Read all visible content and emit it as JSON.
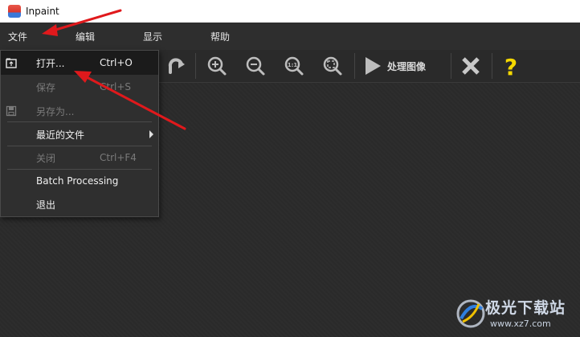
{
  "window": {
    "title": "Inpaint"
  },
  "menubar": {
    "items": [
      {
        "label": "文件"
      },
      {
        "label": "编辑"
      },
      {
        "label": "显示"
      },
      {
        "label": "帮助"
      }
    ]
  },
  "toolbar": {
    "process_label": "处理图像",
    "icons": [
      "redo-icon",
      "zoom-in-icon",
      "zoom-out-icon",
      "zoom-actual-icon",
      "fit-screen-icon",
      "play-icon",
      "close-icon",
      "help-icon"
    ]
  },
  "file_menu": {
    "items": [
      {
        "label": "打开...",
        "shortcut": "Ctrl+O",
        "enabled": true,
        "selected": true,
        "icon": "open-folder-icon"
      },
      {
        "label": "保存",
        "shortcut": "Ctrl+S",
        "enabled": false
      },
      {
        "label": "另存为...",
        "shortcut": "",
        "enabled": false,
        "icon": "save-icon"
      },
      {
        "label": "最近的文件",
        "shortcut": "",
        "enabled": true,
        "submenu": true
      },
      {
        "label": "关闭",
        "shortcut": "Ctrl+F4",
        "enabled": false
      },
      {
        "label": "Batch Processing",
        "shortcut": "",
        "enabled": true
      },
      {
        "label": "退出",
        "shortcut": "",
        "enabled": true
      }
    ]
  },
  "watermark": {
    "name": "极光下载站",
    "url": "www.xz7.com"
  },
  "colors": {
    "annotation_arrow": "#e0191c",
    "help_icon": "#f5d800",
    "background": "#2b2b2b"
  }
}
